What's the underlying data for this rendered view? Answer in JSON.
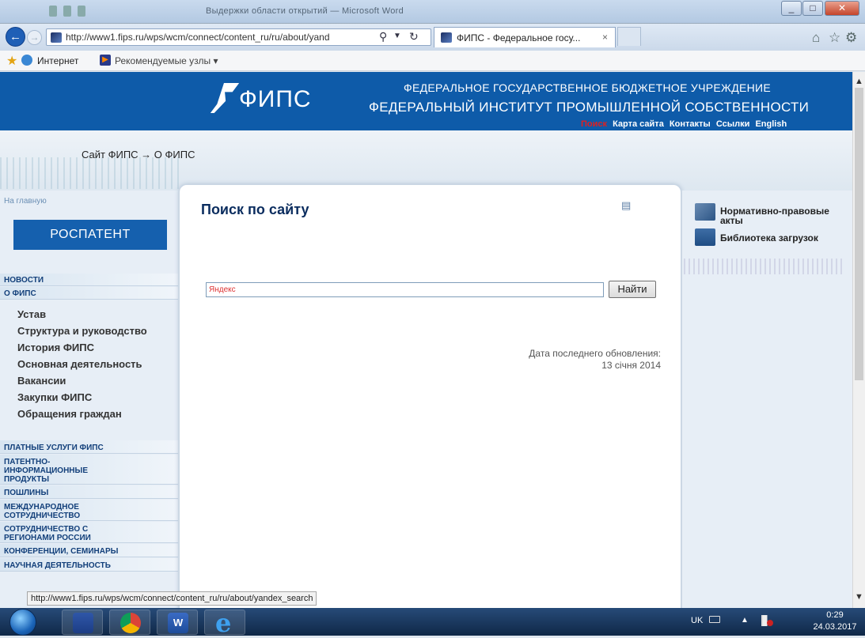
{
  "window": {
    "title": "Выдержки области открытий — Microsoft Word"
  },
  "browser": {
    "address": "http://www1.fips.ru/wps/wcm/connect/content_ru/ru/about/yand",
    "tab_title": "ФИПС - Федеральное госу...",
    "tab_close": "×",
    "favorites": {
      "internet": "Интернет",
      "recommended": "Рекомендуемые узлы ▾"
    }
  },
  "site": {
    "logo": "ФИПС",
    "header_line1": "ФЕДЕРАЛЬНОЕ ГОСУДАРСТВЕННОЕ БЮДЖЕТНОЕ УЧРЕЖДЕНИЕ",
    "header_line2": "ФЕДЕРАЛЬНЫЙ ИНСТИТУТ ПРОМЫШЛЕННОЙ СОБСТВЕННОСТИ",
    "top_links": [
      "Поиск",
      "Карта сайта",
      "Контакты",
      "Ссылки",
      "English"
    ],
    "breadcrumb": "Сайт ФИПС → О ФИПС",
    "home_link": "На главную",
    "rospatent": "РОСПАТЕНТ",
    "nav": [
      "НОВОСТИ",
      "О ФИПС"
    ],
    "sub_nav": [
      "Устав",
      "Структура и руководство",
      "История ФИПС",
      "Основная деятельность",
      "Вакансии",
      "Закупки ФИПС",
      "Обращения граждан"
    ],
    "nav2": [
      "ПЛАТНЫЕ УСЛУГИ ФИПС",
      "ПАТЕНТНО-\nИНФОРМАЦИОННЫЕ\nПРОДУКТЫ",
      "ПОШЛИНЫ",
      "МЕЖДУНАРОДНОЕ\nСОТРУДНИЧЕСТВО",
      "СОТРУДНИЧЕСТВО С\nРЕГИОНАМИ РОССИИ",
      "КОНФЕРЕНЦИИ, СЕМИНАРЫ",
      "НАУЧНАЯ ДЕЯТЕЛЬНОСТЬ"
    ],
    "content_title": "Поиск по сайту",
    "search_placeholder": "Яндекс",
    "search_button": "Найти",
    "updated_label": "Дата последнего обновления:",
    "updated_date": "13 січня 2014",
    "right_links": [
      "Нормативно-правовые акты",
      "Библиотека загрузок"
    ]
  },
  "status_url": "http://www1.fips.ru/wps/wcm/connect/content_ru/ru/about/yandex_search",
  "taskbar": {
    "lang": "UK",
    "time": "0:29",
    "date": "24.03.2017"
  }
}
